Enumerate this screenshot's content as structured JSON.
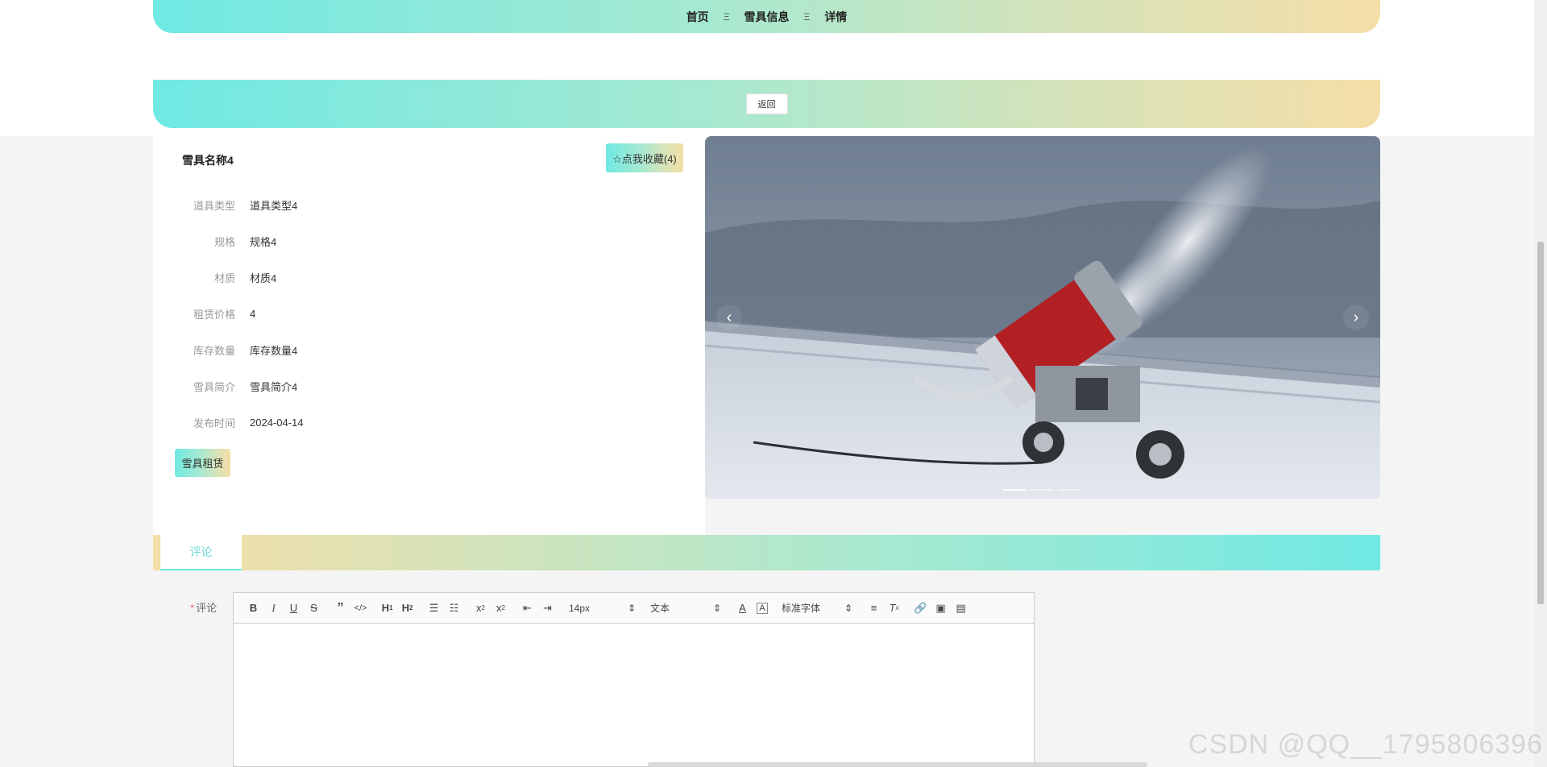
{
  "breadcrumb": {
    "home": "首页",
    "list": "雪具信息",
    "current": "详情",
    "separator": "Ξ"
  },
  "back_label": "返回",
  "item": {
    "name": "雪具名称4",
    "favorite_label": "☆点我收藏(4)",
    "fields": [
      {
        "label": "道具类型",
        "value": "道具类型4"
      },
      {
        "label": "规格",
        "value": "规格4"
      },
      {
        "label": "材质",
        "value": "材质4"
      },
      {
        "label": "租赁价格",
        "value": "4"
      },
      {
        "label": "库存数量",
        "value": "库存数量4"
      },
      {
        "label": "雪具简介",
        "value": "雪具简介4"
      },
      {
        "label": "发布时间",
        "value": "2024-04-14"
      }
    ],
    "rent_label": "雪具租赁"
  },
  "carousel": {
    "prev": "‹",
    "next": "›"
  },
  "tabs": {
    "comment": "评论"
  },
  "comment": {
    "required_mark": "*",
    "label": "评论",
    "toolbar": {
      "size": "14px",
      "header": "文本",
      "font": "标准字体"
    }
  },
  "watermark": "CSDN @QQ__1795806396",
  "colors": {
    "grad_start": "#6fe9e3",
    "grad_end": "#f5dea7",
    "accent": "#6fd9d3"
  }
}
